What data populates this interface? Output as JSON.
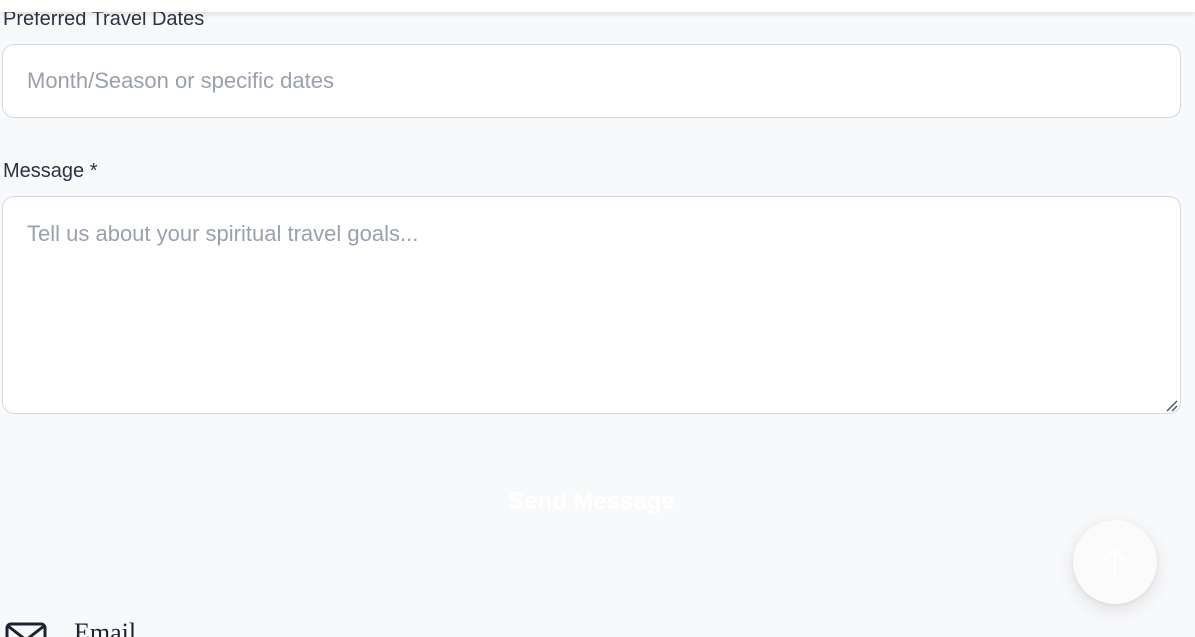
{
  "form": {
    "travel_dates": {
      "label": "Preferred Travel Dates",
      "placeholder": "Month/Season or specific dates",
      "value": ""
    },
    "message": {
      "label": "Message *",
      "placeholder": "Tell us about your spiritual travel goals...",
      "value": ""
    },
    "submit_label": "Send Message"
  },
  "contact": {
    "email_title": "Email",
    "email_icon": "mail-icon"
  },
  "back_to_top_icon": "arrow-up-icon",
  "colors": {
    "background": "#f8f9fb",
    "field_border": "#d4d9e1",
    "label_text": "#2b3340",
    "placeholder_text": "#9aa1ac"
  }
}
